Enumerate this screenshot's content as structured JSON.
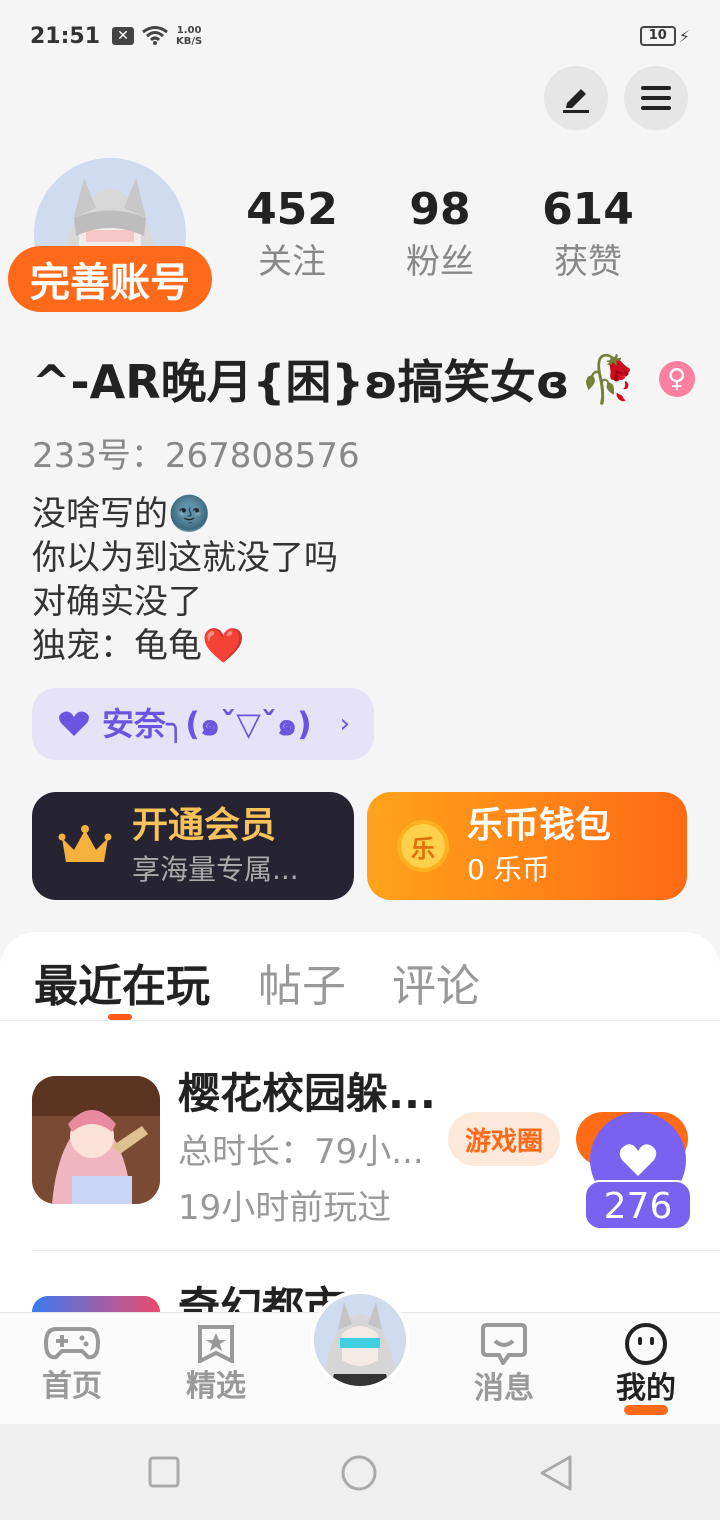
{
  "status_bar": {
    "time": "21:51",
    "speed_value": "1.00",
    "speed_unit": "KB/S",
    "battery": "10"
  },
  "profile": {
    "complete_badge": "完善账号",
    "stats": [
      {
        "value": "452",
        "label": "关注"
      },
      {
        "value": "98",
        "label": "粉丝"
      },
      {
        "value": "614",
        "label": "获赞"
      }
    ],
    "nickname": "^-AR晚月{困}ʚ搞笑女ɞ",
    "nickname_emoji": "🥀",
    "uid": "233号：267808576",
    "bio_lines": [
      "没啥写的🌚",
      "你以为到这就没了吗",
      "对确实没了",
      "独宠：龟龟❤️"
    ],
    "guild": "安奈╮(๑ˇ▽ˇ๑)"
  },
  "cards": {
    "vip": {
      "title": "开通会员",
      "subtitle": "享海量专属..."
    },
    "wallet": {
      "title": "乐币钱包",
      "subtitle": "0 乐币",
      "coin_glyph": "乐"
    }
  },
  "tabs": [
    "最近在玩",
    "帖子",
    "评论"
  ],
  "games": [
    {
      "title": "樱花校园躲...",
      "duration": "总时长：79小...",
      "last_played": "19小时前玩过",
      "circle_label": "游戏圈",
      "likes": "276"
    },
    {
      "title": "奇幻都市"
    }
  ],
  "bottom_nav": [
    {
      "label": "首页",
      "icon": "gamepad-icon"
    },
    {
      "label": "精选",
      "icon": "star-bookmark-icon"
    },
    {
      "label": "",
      "icon": "avatar"
    },
    {
      "label": "消息",
      "icon": "chat-icon"
    },
    {
      "label": "我的",
      "icon": "smile-face-icon"
    }
  ],
  "colors": {
    "accent": "#ff6a1a",
    "purple": "#7a62f0",
    "vip_bg": "#262433"
  }
}
